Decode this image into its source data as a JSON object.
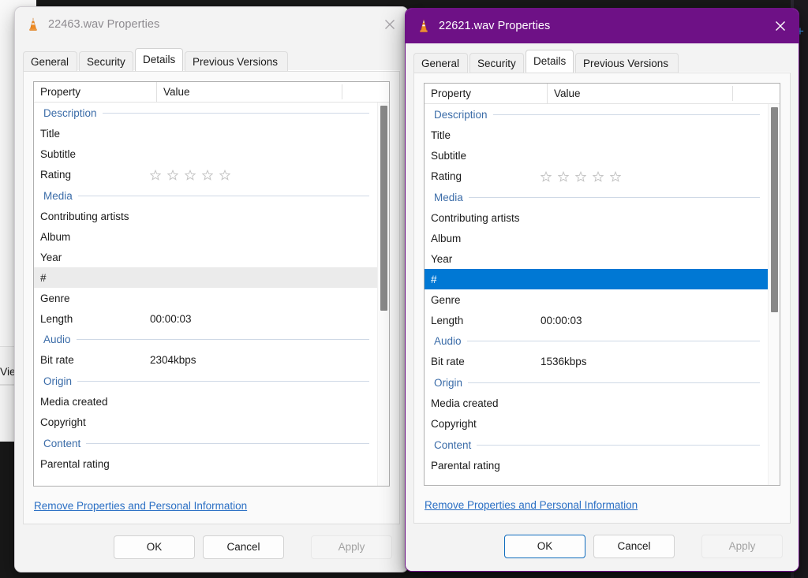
{
  "background": {
    "explorer_fragment_label": "Vie",
    "right_panel_plus_icon": "plus-icon"
  },
  "colors": {
    "active_titlebar": "#6e1186",
    "inactive_titlebar": "#f3f3f3",
    "selection_blue": "#0078d4",
    "group_header_blue": "#3b6ca8",
    "link_blue": "#2a6fc4",
    "focus_border": "#0f6cbd"
  },
  "windows": [
    {
      "id": "window-22463",
      "state": "inactive",
      "title": "22463.wav Properties",
      "app_icon": "vlc-cone-icon",
      "close_label": "Close",
      "tabs": [
        {
          "label": "General",
          "selected": false
        },
        {
          "label": "Security",
          "selected": false
        },
        {
          "label": "Details",
          "selected": true
        },
        {
          "label": "Previous Versions",
          "selected": false
        }
      ],
      "list": {
        "columns": [
          "Property",
          "Value"
        ],
        "rows": [
          {
            "type": "group",
            "name": "Description"
          },
          {
            "type": "property",
            "name": "Title",
            "value": ""
          },
          {
            "type": "property",
            "name": "Subtitle",
            "value": ""
          },
          {
            "type": "property",
            "name": "Rating",
            "value": "",
            "widget": "stars",
            "stars": 0
          },
          {
            "type": "group",
            "name": "Media"
          },
          {
            "type": "property",
            "name": "Contributing artists",
            "value": ""
          },
          {
            "type": "property",
            "name": "Album",
            "value": ""
          },
          {
            "type": "property",
            "name": "Year",
            "value": ""
          },
          {
            "type": "property",
            "name": "#",
            "value": "",
            "highlight": "shaded"
          },
          {
            "type": "property",
            "name": "Genre",
            "value": ""
          },
          {
            "type": "property",
            "name": "Length",
            "value": "00:00:03"
          },
          {
            "type": "group",
            "name": "Audio"
          },
          {
            "type": "property",
            "name": "Bit rate",
            "value": "2304kbps"
          },
          {
            "type": "group",
            "name": "Origin"
          },
          {
            "type": "property",
            "name": "Media created",
            "value": ""
          },
          {
            "type": "property",
            "name": "Copyright",
            "value": ""
          },
          {
            "type": "group",
            "name": "Content"
          },
          {
            "type": "property",
            "name": "Parental rating",
            "value": ""
          }
        ]
      },
      "remove_link": "Remove Properties and Personal Information",
      "buttons": {
        "ok": {
          "label": "OK",
          "style": "normal"
        },
        "cancel": {
          "label": "Cancel",
          "style": "normal"
        },
        "apply": {
          "label": "Apply",
          "style": "disabled"
        }
      }
    },
    {
      "id": "window-22621",
      "state": "active",
      "title": "22621.wav Properties",
      "app_icon": "vlc-cone-icon",
      "close_label": "Close",
      "tabs": [
        {
          "label": "General",
          "selected": false
        },
        {
          "label": "Security",
          "selected": false
        },
        {
          "label": "Details",
          "selected": true
        },
        {
          "label": "Previous Versions",
          "selected": false
        }
      ],
      "list": {
        "columns": [
          "Property",
          "Value"
        ],
        "rows": [
          {
            "type": "group",
            "name": "Description"
          },
          {
            "type": "property",
            "name": "Title",
            "value": ""
          },
          {
            "type": "property",
            "name": "Subtitle",
            "value": ""
          },
          {
            "type": "property",
            "name": "Rating",
            "value": "",
            "widget": "stars",
            "stars": 0
          },
          {
            "type": "group",
            "name": "Media"
          },
          {
            "type": "property",
            "name": "Contributing artists",
            "value": ""
          },
          {
            "type": "property",
            "name": "Album",
            "value": ""
          },
          {
            "type": "property",
            "name": "Year",
            "value": ""
          },
          {
            "type": "property",
            "name": "#",
            "value": "",
            "highlight": "selected"
          },
          {
            "type": "property",
            "name": "Genre",
            "value": ""
          },
          {
            "type": "property",
            "name": "Length",
            "value": "00:00:03"
          },
          {
            "type": "group",
            "name": "Audio"
          },
          {
            "type": "property",
            "name": "Bit rate",
            "value": "1536kbps"
          },
          {
            "type": "group",
            "name": "Origin"
          },
          {
            "type": "property",
            "name": "Media created",
            "value": ""
          },
          {
            "type": "property",
            "name": "Copyright",
            "value": ""
          },
          {
            "type": "group",
            "name": "Content"
          },
          {
            "type": "property",
            "name": "Parental rating",
            "value": ""
          }
        ]
      },
      "remove_link": "Remove Properties and Personal Information",
      "buttons": {
        "ok": {
          "label": "OK",
          "style": "default-focus"
        },
        "cancel": {
          "label": "Cancel",
          "style": "normal"
        },
        "apply": {
          "label": "Apply",
          "style": "disabled"
        }
      }
    }
  ]
}
